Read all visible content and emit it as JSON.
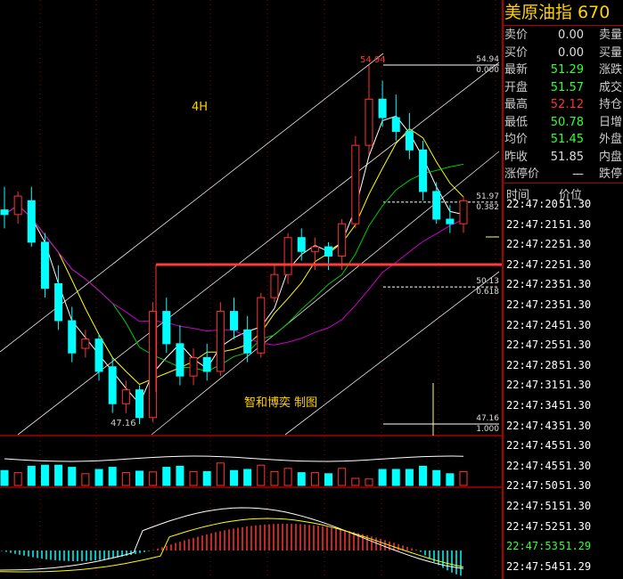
{
  "chart_data": {
    "type": "candlestick",
    "annotations": {
      "timeframe": "4H",
      "watermark": "智和博奕  制图",
      "high_label": "54.94",
      "low_label": "47.16"
    },
    "fib_levels": [
      {
        "price": "54.94",
        "ratio": "0.000"
      },
      {
        "price": "51.97",
        "ratio": "0.382"
      },
      {
        "price": "50.13",
        "ratio": "0.618"
      },
      {
        "price": "47.16",
        "ratio": "1.000"
      }
    ],
    "candles": [
      {
        "o": 51.8,
        "h": 52.3,
        "l": 51.4,
        "c": 51.7
      },
      {
        "o": 51.7,
        "h": 52.2,
        "l": 51.5,
        "c": 52.1
      },
      {
        "o": 52.0,
        "h": 52.3,
        "l": 51.0,
        "c": 51.1
      },
      {
        "o": 51.1,
        "h": 51.3,
        "l": 49.9,
        "c": 50.1
      },
      {
        "o": 50.2,
        "h": 50.6,
        "l": 49.2,
        "c": 49.4
      },
      {
        "o": 49.4,
        "h": 49.7,
        "l": 48.5,
        "c": 48.7
      },
      {
        "o": 48.8,
        "h": 49.2,
        "l": 48.6,
        "c": 49.0
      },
      {
        "o": 49.0,
        "h": 49.1,
        "l": 48.1,
        "c": 48.3
      },
      {
        "o": 48.4,
        "h": 48.6,
        "l": 47.4,
        "c": 47.6
      },
      {
        "o": 47.6,
        "h": 48.1,
        "l": 47.4,
        "c": 47.9
      },
      {
        "o": 47.9,
        "h": 48.0,
        "l": 47.16,
        "c": 47.3
      },
      {
        "o": 47.3,
        "h": 49.8,
        "l": 47.2,
        "c": 49.6
      },
      {
        "o": 49.6,
        "h": 49.9,
        "l": 48.7,
        "c": 48.9
      },
      {
        "o": 48.9,
        "h": 49.3,
        "l": 48.0,
        "c": 48.2
      },
      {
        "o": 48.2,
        "h": 48.8,
        "l": 48.0,
        "c": 48.6
      },
      {
        "o": 48.6,
        "h": 48.9,
        "l": 48.1,
        "c": 48.3
      },
      {
        "o": 48.3,
        "h": 49.8,
        "l": 48.2,
        "c": 49.6
      },
      {
        "o": 49.6,
        "h": 49.9,
        "l": 49.0,
        "c": 49.2
      },
      {
        "o": 49.2,
        "h": 49.5,
        "l": 48.5,
        "c": 48.7
      },
      {
        "o": 48.7,
        "h": 50.0,
        "l": 48.6,
        "c": 49.9
      },
      {
        "o": 49.9,
        "h": 50.6,
        "l": 49.8,
        "c": 50.4
      },
      {
        "o": 50.4,
        "h": 51.3,
        "l": 50.2,
        "c": 51.2
      },
      {
        "o": 51.2,
        "h": 51.4,
        "l": 50.7,
        "c": 50.9
      },
      {
        "o": 50.9,
        "h": 51.2,
        "l": 50.5,
        "c": 51.0
      },
      {
        "o": 51.0,
        "h": 51.1,
        "l": 50.5,
        "c": 50.8
      },
      {
        "o": 50.8,
        "h": 51.6,
        "l": 50.5,
        "c": 51.5
      },
      {
        "o": 51.5,
        "h": 53.4,
        "l": 51.4,
        "c": 53.2
      },
      {
        "o": 53.2,
        "h": 54.94,
        "l": 53.0,
        "c": 54.2
      },
      {
        "o": 54.2,
        "h": 54.6,
        "l": 53.6,
        "c": 53.8
      },
      {
        "o": 53.8,
        "h": 54.3,
        "l": 53.3,
        "c": 53.5
      },
      {
        "o": 53.5,
        "h": 53.9,
        "l": 52.9,
        "c": 53.1
      },
      {
        "o": 53.1,
        "h": 53.3,
        "l": 52.0,
        "c": 52.2
      },
      {
        "o": 52.2,
        "h": 52.4,
        "l": 51.5,
        "c": 51.6
      },
      {
        "o": 51.6,
        "h": 51.9,
        "l": 51.3,
        "c": 51.5
      },
      {
        "o": 51.5,
        "h": 52.1,
        "l": 51.3,
        "c": 52.0
      }
    ]
  },
  "panel": {
    "title": "美原油指  670",
    "quote": [
      {
        "label": "卖价",
        "value": "0.00",
        "label2": "卖量",
        "color": "#dddddd"
      },
      {
        "label": "买价",
        "value": "0.00",
        "label2": "买量",
        "color": "#dddddd"
      },
      {
        "label": "最新",
        "value": "51.29",
        "label2": "涨跌",
        "color": "#33ff33"
      },
      {
        "label": "开盘",
        "value": "51.57",
        "label2": "成交",
        "color": "#33ff33"
      },
      {
        "label": "最高",
        "value": "52.12",
        "label2": "持仓",
        "color": "#ff3333"
      },
      {
        "label": "最低",
        "value": "50.78",
        "label2": "日增",
        "color": "#33ff33"
      },
      {
        "label": "均价",
        "value": "51.45",
        "label2": "外盘",
        "color": "#33ff33"
      },
      {
        "label": "昨收",
        "value": "51.85",
        "label2": "内盘",
        "color": "#dddddd"
      },
      {
        "label": "涨停价",
        "value": "—",
        "label2": "跌停",
        "color": "#dddddd"
      }
    ],
    "tick_header": {
      "time": "时间",
      "price": "价位"
    },
    "ticks": [
      {
        "time": "22:47:20",
        "price": "51.30",
        "color": "#ffffff"
      },
      {
        "time": "22:47:21",
        "price": "51.30",
        "color": "#ffffff"
      },
      {
        "time": "22:47:22",
        "price": "51.30",
        "color": "#ffffff"
      },
      {
        "time": "22:47:22",
        "price": "51.30",
        "color": "#ffffff"
      },
      {
        "time": "22:47:23",
        "price": "51.30",
        "color": "#ffffff"
      },
      {
        "time": "22:47:23",
        "price": "51.30",
        "color": "#ffffff"
      },
      {
        "time": "22:47:24",
        "price": "51.30",
        "color": "#ffffff"
      },
      {
        "time": "22:47:25",
        "price": "51.30",
        "color": "#ffffff"
      },
      {
        "time": "22:47:28",
        "price": "51.30",
        "color": "#ffffff"
      },
      {
        "time": "22:47:31",
        "price": "51.30",
        "color": "#ffffff"
      },
      {
        "time": "22:47:34",
        "price": "51.30",
        "color": "#ffffff"
      },
      {
        "time": "22:47:43",
        "price": "51.30",
        "color": "#ffffff"
      },
      {
        "time": "22:47:45",
        "price": "51.30",
        "color": "#ffffff"
      },
      {
        "time": "22:47:45",
        "price": "51.30",
        "color": "#ffffff"
      },
      {
        "time": "22:47:50",
        "price": "51.30",
        "color": "#ffffff"
      },
      {
        "time": "22:47:51",
        "price": "51.30",
        "color": "#ffffff"
      },
      {
        "time": "22:47:52",
        "price": "51.30",
        "color": "#ffffff"
      },
      {
        "time": "22:47:53",
        "price": "51.29",
        "color": "#33ff33"
      },
      {
        "time": "22:47:54",
        "price": "51.29",
        "color": "#ffffff"
      }
    ]
  },
  "colors": {
    "up": "#ff3333",
    "down": "#00ffff",
    "fib": "#ffffff",
    "arrow": "#ff3a3a",
    "ma_fast": "#ffffff",
    "ma_mid": "#ffff00",
    "ma_slow": "#00cc00",
    "ma_long": "#cc00cc",
    "title": "#ffd200",
    "grid": "#8b0000"
  }
}
